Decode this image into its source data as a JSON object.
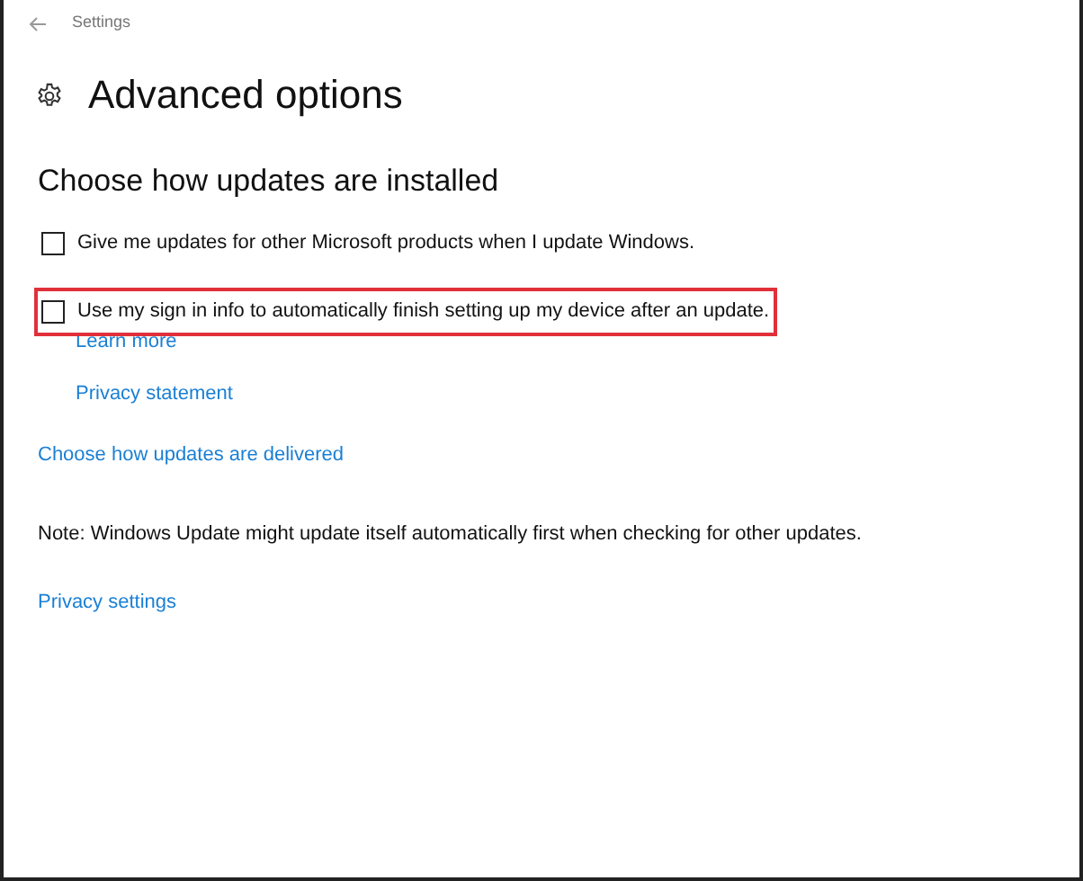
{
  "window": {
    "title": "Settings"
  },
  "page": {
    "title": "Advanced options"
  },
  "section": {
    "title": "Choose how updates are installed"
  },
  "options": [
    {
      "label": "Give me updates for other Microsoft products when I update Windows.",
      "checked": false,
      "highlighted": false
    },
    {
      "label": "Use my sign in info to automatically finish setting up my device after an update.",
      "checked": false,
      "highlighted": true
    }
  ],
  "option_links": [
    "Learn more",
    "Privacy statement"
  ],
  "delivery_link": "Choose how updates are delivered",
  "note": "Note: Windows Update might update itself automatically first when checking for other updates.",
  "privacy_link": "Privacy settings"
}
